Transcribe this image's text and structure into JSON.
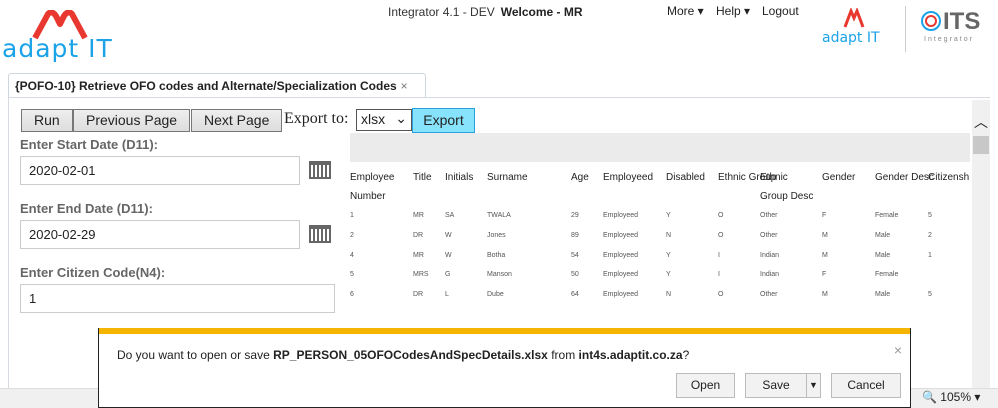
{
  "header": {
    "app_title": "Integrator 4.1 - DEV",
    "welcome": "Welcome - MR",
    "menu": [
      "More",
      "Help",
      "Logout"
    ],
    "logo_left": "adapt IT",
    "logo_right": "adapt IT",
    "its_logo": "ITS",
    "its_sub": "Integrator"
  },
  "tab": {
    "label": "{POFO-10} Retrieve OFO codes and Alternate/Specialization Codes",
    "close": "×"
  },
  "toolbar": {
    "run": "Run",
    "prev": "Previous Page",
    "next": "Next Page",
    "export_to": "Export to:",
    "format": "xlsx",
    "export": "Export"
  },
  "form": {
    "start_label": "Enter Start Date (D11):",
    "start_value": "2020-02-01",
    "end_label": "Enter End Date (D11):",
    "end_value": "2020-02-29",
    "citizen_label": "Enter Citizen Code(N4):",
    "citizen_value": "1"
  },
  "table": {
    "columns": [
      "Employee Number",
      "Title",
      "Initials",
      "Surname",
      "Age",
      "Employeed",
      "Disabled",
      "Ethnic Group",
      "Ethnic Group Desc",
      "Gender",
      "Gender Desc",
      "Citizensh"
    ],
    "rows": [
      [
        "1",
        "MR",
        "SA",
        "TWALA",
        "29",
        "Employeed",
        "Y",
        "O",
        "Other",
        "F",
        "Female",
        "5"
      ],
      [
        "2",
        "DR",
        "W",
        "Jones",
        "89",
        "Employeed",
        "N",
        "O",
        "Other",
        "M",
        "Male",
        "2"
      ],
      [
        "4",
        "MR",
        "W",
        "Botha",
        "54",
        "Employeed",
        "Y",
        "I",
        "Indian",
        "M",
        "Male",
        "1"
      ],
      [
        "5",
        "MRS",
        "G",
        "Manson",
        "50",
        "Employeed",
        "Y",
        "I",
        "Indian",
        "F",
        "Female",
        ""
      ],
      [
        "6",
        "DR",
        "L",
        "Dube",
        "64",
        "Employeed",
        "N",
        "O",
        "Other",
        "M",
        "Male",
        "5"
      ]
    ]
  },
  "dialog": {
    "prefix": "Do you want to open or save ",
    "filename": "RP_PERSON_05OFOCodesAndSpecDetails.xlsx",
    "from": " from ",
    "host": "int4s.adaptit.co.za",
    "suffix": "?",
    "open": "Open",
    "save": "Save",
    "cancel": "Cancel",
    "close": "×"
  },
  "status": {
    "zoom": "105%"
  },
  "colors": {
    "accent": "#f5b400",
    "export_bg": "#86e3fb",
    "logo_red": "#e8382f",
    "logo_blue": "#1aa3e8"
  }
}
